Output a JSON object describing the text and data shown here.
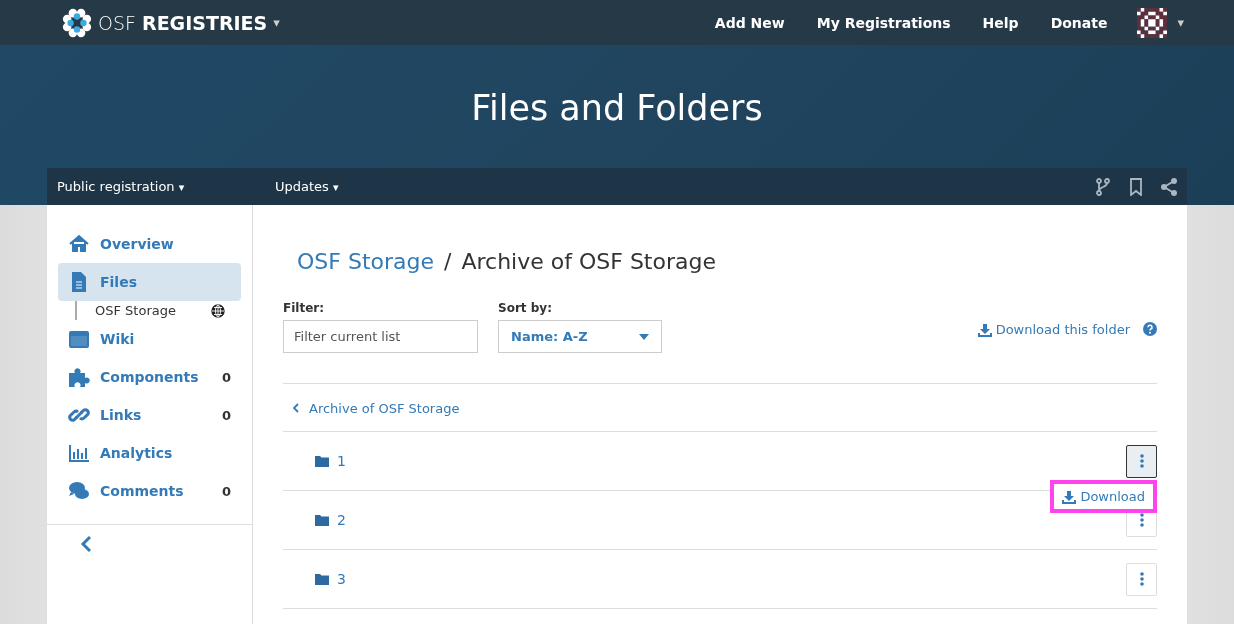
{
  "navbar": {
    "brand_light": "OSF",
    "brand_bold": "REGISTRIES",
    "brand_caret": "▾",
    "links": [
      "Add New",
      "My Registrations",
      "Help",
      "Donate"
    ],
    "user_caret": "▾"
  },
  "hero": {
    "title": "Files and Folders"
  },
  "subnav": {
    "items": [
      {
        "label": "Public registration",
        "caret": "▾"
      },
      {
        "label": "Updates",
        "caret": "▾"
      }
    ]
  },
  "sidebar": {
    "items": [
      {
        "label": "Overview",
        "selected": false
      },
      {
        "label": "Files",
        "selected": true,
        "children": [
          {
            "label": "OSF Storage"
          }
        ]
      },
      {
        "label": "Wiki",
        "selected": false
      },
      {
        "label": "Components",
        "count": "0",
        "selected": false
      },
      {
        "label": "Links",
        "count": "0",
        "selected": false
      },
      {
        "label": "Analytics",
        "selected": false
      },
      {
        "label": "Comments",
        "count": "0",
        "selected": false
      }
    ]
  },
  "breadcrumb": {
    "link": "OSF Storage",
    "separator": "/",
    "current": "Archive of OSF Storage"
  },
  "filter": {
    "label": "Filter:",
    "placeholder": "Filter current list"
  },
  "sort": {
    "label": "Sort by:",
    "value": "Name: A-Z"
  },
  "download_folder": "Download this folder",
  "back_link": "Archive of OSF Storage",
  "rows": [
    {
      "name": "1",
      "menu_open": true
    },
    {
      "name": "2",
      "menu_open": false
    },
    {
      "name": "3",
      "menu_open": false
    }
  ],
  "menu": {
    "item": "Download",
    "highlighted": true
  }
}
